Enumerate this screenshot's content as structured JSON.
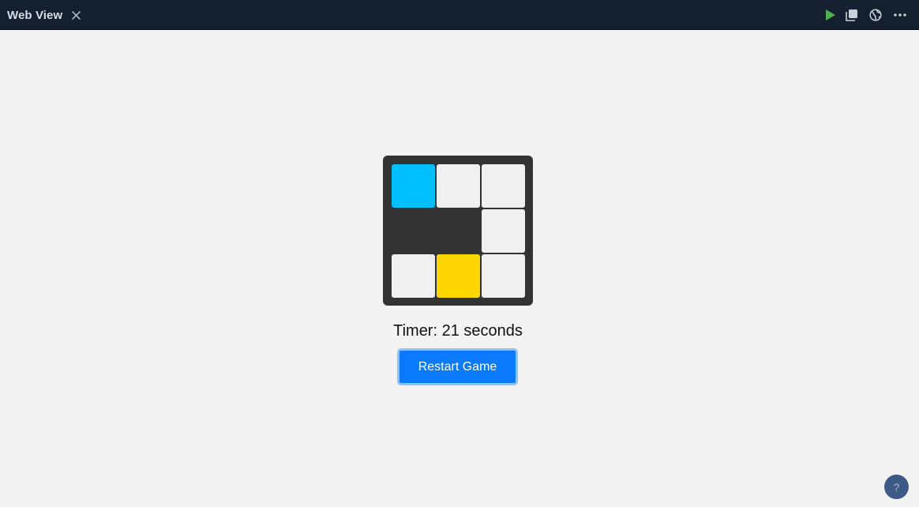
{
  "window": {
    "tab_title": "Web View",
    "close_icon": "close-icon",
    "actions": [
      {
        "name": "run",
        "icon": "play-icon",
        "color": "#4caf50"
      },
      {
        "name": "copy",
        "icon": "copy-icon",
        "color": "#c8cfd8"
      },
      {
        "name": "open-browser",
        "icon": "globe-icon",
        "color": "#c8cfd8"
      },
      {
        "name": "more",
        "icon": "more-icon",
        "color": "#c8cfd8"
      }
    ]
  },
  "game": {
    "grid": {
      "rows": 3,
      "cols": 3,
      "cells": [
        [
          "blue",
          "light",
          "light"
        ],
        [
          "empty",
          "empty",
          "light"
        ],
        [
          "light",
          "yellow",
          "light"
        ]
      ]
    },
    "colors": {
      "board": "#333333",
      "light": "#f0f0f0",
      "blue": "#00bfff",
      "yellow": "#ffd700"
    },
    "timer_text": "Timer: 21 seconds",
    "restart_label": "Restart Game"
  },
  "help": {
    "label": "?"
  }
}
